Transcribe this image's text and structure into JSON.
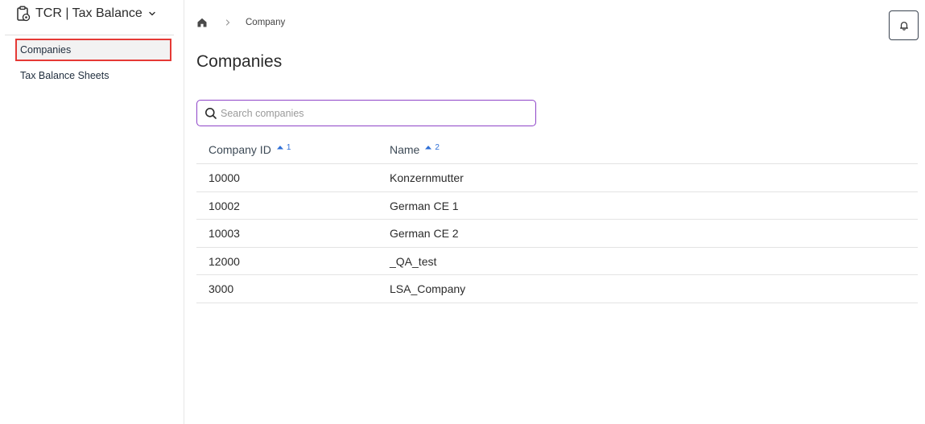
{
  "sidebar": {
    "app_title": "TCR | Tax Balance",
    "items": [
      {
        "label": "Companies",
        "active": true
      },
      {
        "label": "Tax Balance Sheets",
        "active": false
      }
    ]
  },
  "breadcrumb": {
    "current": "Company"
  },
  "page": {
    "title": "Companies"
  },
  "search": {
    "placeholder": "Search companies",
    "value": ""
  },
  "table": {
    "columns": [
      {
        "label": "Company ID",
        "sort": "ascending",
        "sort_index": "1"
      },
      {
        "label": "Name",
        "sort": "ascending",
        "sort_index": "2"
      }
    ],
    "rows": [
      {
        "id": "10000",
        "name": "Konzernmutter"
      },
      {
        "id": "10002",
        "name": "German CE 1"
      },
      {
        "id": "10003",
        "name": "German CE 2"
      },
      {
        "id": "12000",
        "name": "_QA_test"
      },
      {
        "id": "3000",
        "name": "LSA_Company"
      }
    ]
  },
  "colors": {
    "active_outline": "#e53935",
    "search_border": "#8e44c8",
    "sort_accent": "#2f6fd6"
  },
  "icons": {
    "app": "clipboard-settings-icon",
    "switcher": "chevron-down-icon",
    "home": "home-icon",
    "separator": "chevron-right-icon",
    "notifications": "bell-icon",
    "search": "search-icon",
    "sort": "sort-up-icon"
  }
}
